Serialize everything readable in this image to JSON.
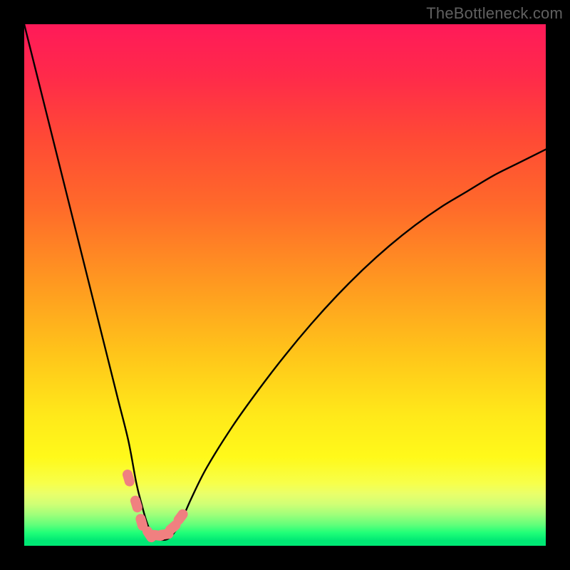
{
  "watermark": "TheBottleneck.com",
  "chart_data": {
    "type": "line",
    "title": "",
    "xlabel": "",
    "ylabel": "",
    "xlim": [
      0,
      100
    ],
    "ylim": [
      0,
      100
    ],
    "x": [
      0,
      2,
      4,
      6,
      8,
      10,
      12,
      14,
      16,
      18,
      20,
      21.5,
      22.5,
      23.5,
      24.5,
      25.5,
      26.5,
      27.5,
      28.5,
      30,
      32,
      35,
      40,
      45,
      50,
      55,
      60,
      65,
      70,
      75,
      80,
      85,
      90,
      95,
      100
    ],
    "y": [
      100,
      92,
      84,
      76,
      68,
      60,
      52,
      44,
      36,
      28,
      20,
      12,
      8,
      4.5,
      2.2,
      1.3,
      1.1,
      1.3,
      2.2,
      4.5,
      9,
      15,
      23,
      30,
      36.5,
      42.5,
      48,
      53,
      57.5,
      61.5,
      65,
      68,
      71,
      73.5,
      76
    ],
    "markers": {
      "x": [
        20,
        21.5,
        22.5,
        24,
        25.5,
        27,
        28.5,
        30
      ],
      "y": [
        13,
        8,
        4.5,
        2.2,
        2.0,
        2.2,
        3.5,
        5.5
      ],
      "color": "#f08080"
    },
    "gradient_stops": [
      {
        "offset": 0.0,
        "color": "#ff1a59"
      },
      {
        "offset": 0.1,
        "color": "#ff2a4a"
      },
      {
        "offset": 0.22,
        "color": "#ff4a35"
      },
      {
        "offset": 0.35,
        "color": "#ff6a2a"
      },
      {
        "offset": 0.5,
        "color": "#ff9a20"
      },
      {
        "offset": 0.63,
        "color": "#ffc41a"
      },
      {
        "offset": 0.75,
        "color": "#ffe91a"
      },
      {
        "offset": 0.83,
        "color": "#fff91a"
      },
      {
        "offset": 0.88,
        "color": "#f7ff4a"
      },
      {
        "offset": 0.9,
        "color": "#eaff6a"
      },
      {
        "offset": 0.92,
        "color": "#d0ff75"
      },
      {
        "offset": 0.94,
        "color": "#a0ff7a"
      },
      {
        "offset": 0.96,
        "color": "#60ff7a"
      },
      {
        "offset": 0.975,
        "color": "#20ff78"
      },
      {
        "offset": 0.99,
        "color": "#00e874"
      },
      {
        "offset": 1.0,
        "color": "#00e874"
      }
    ]
  }
}
